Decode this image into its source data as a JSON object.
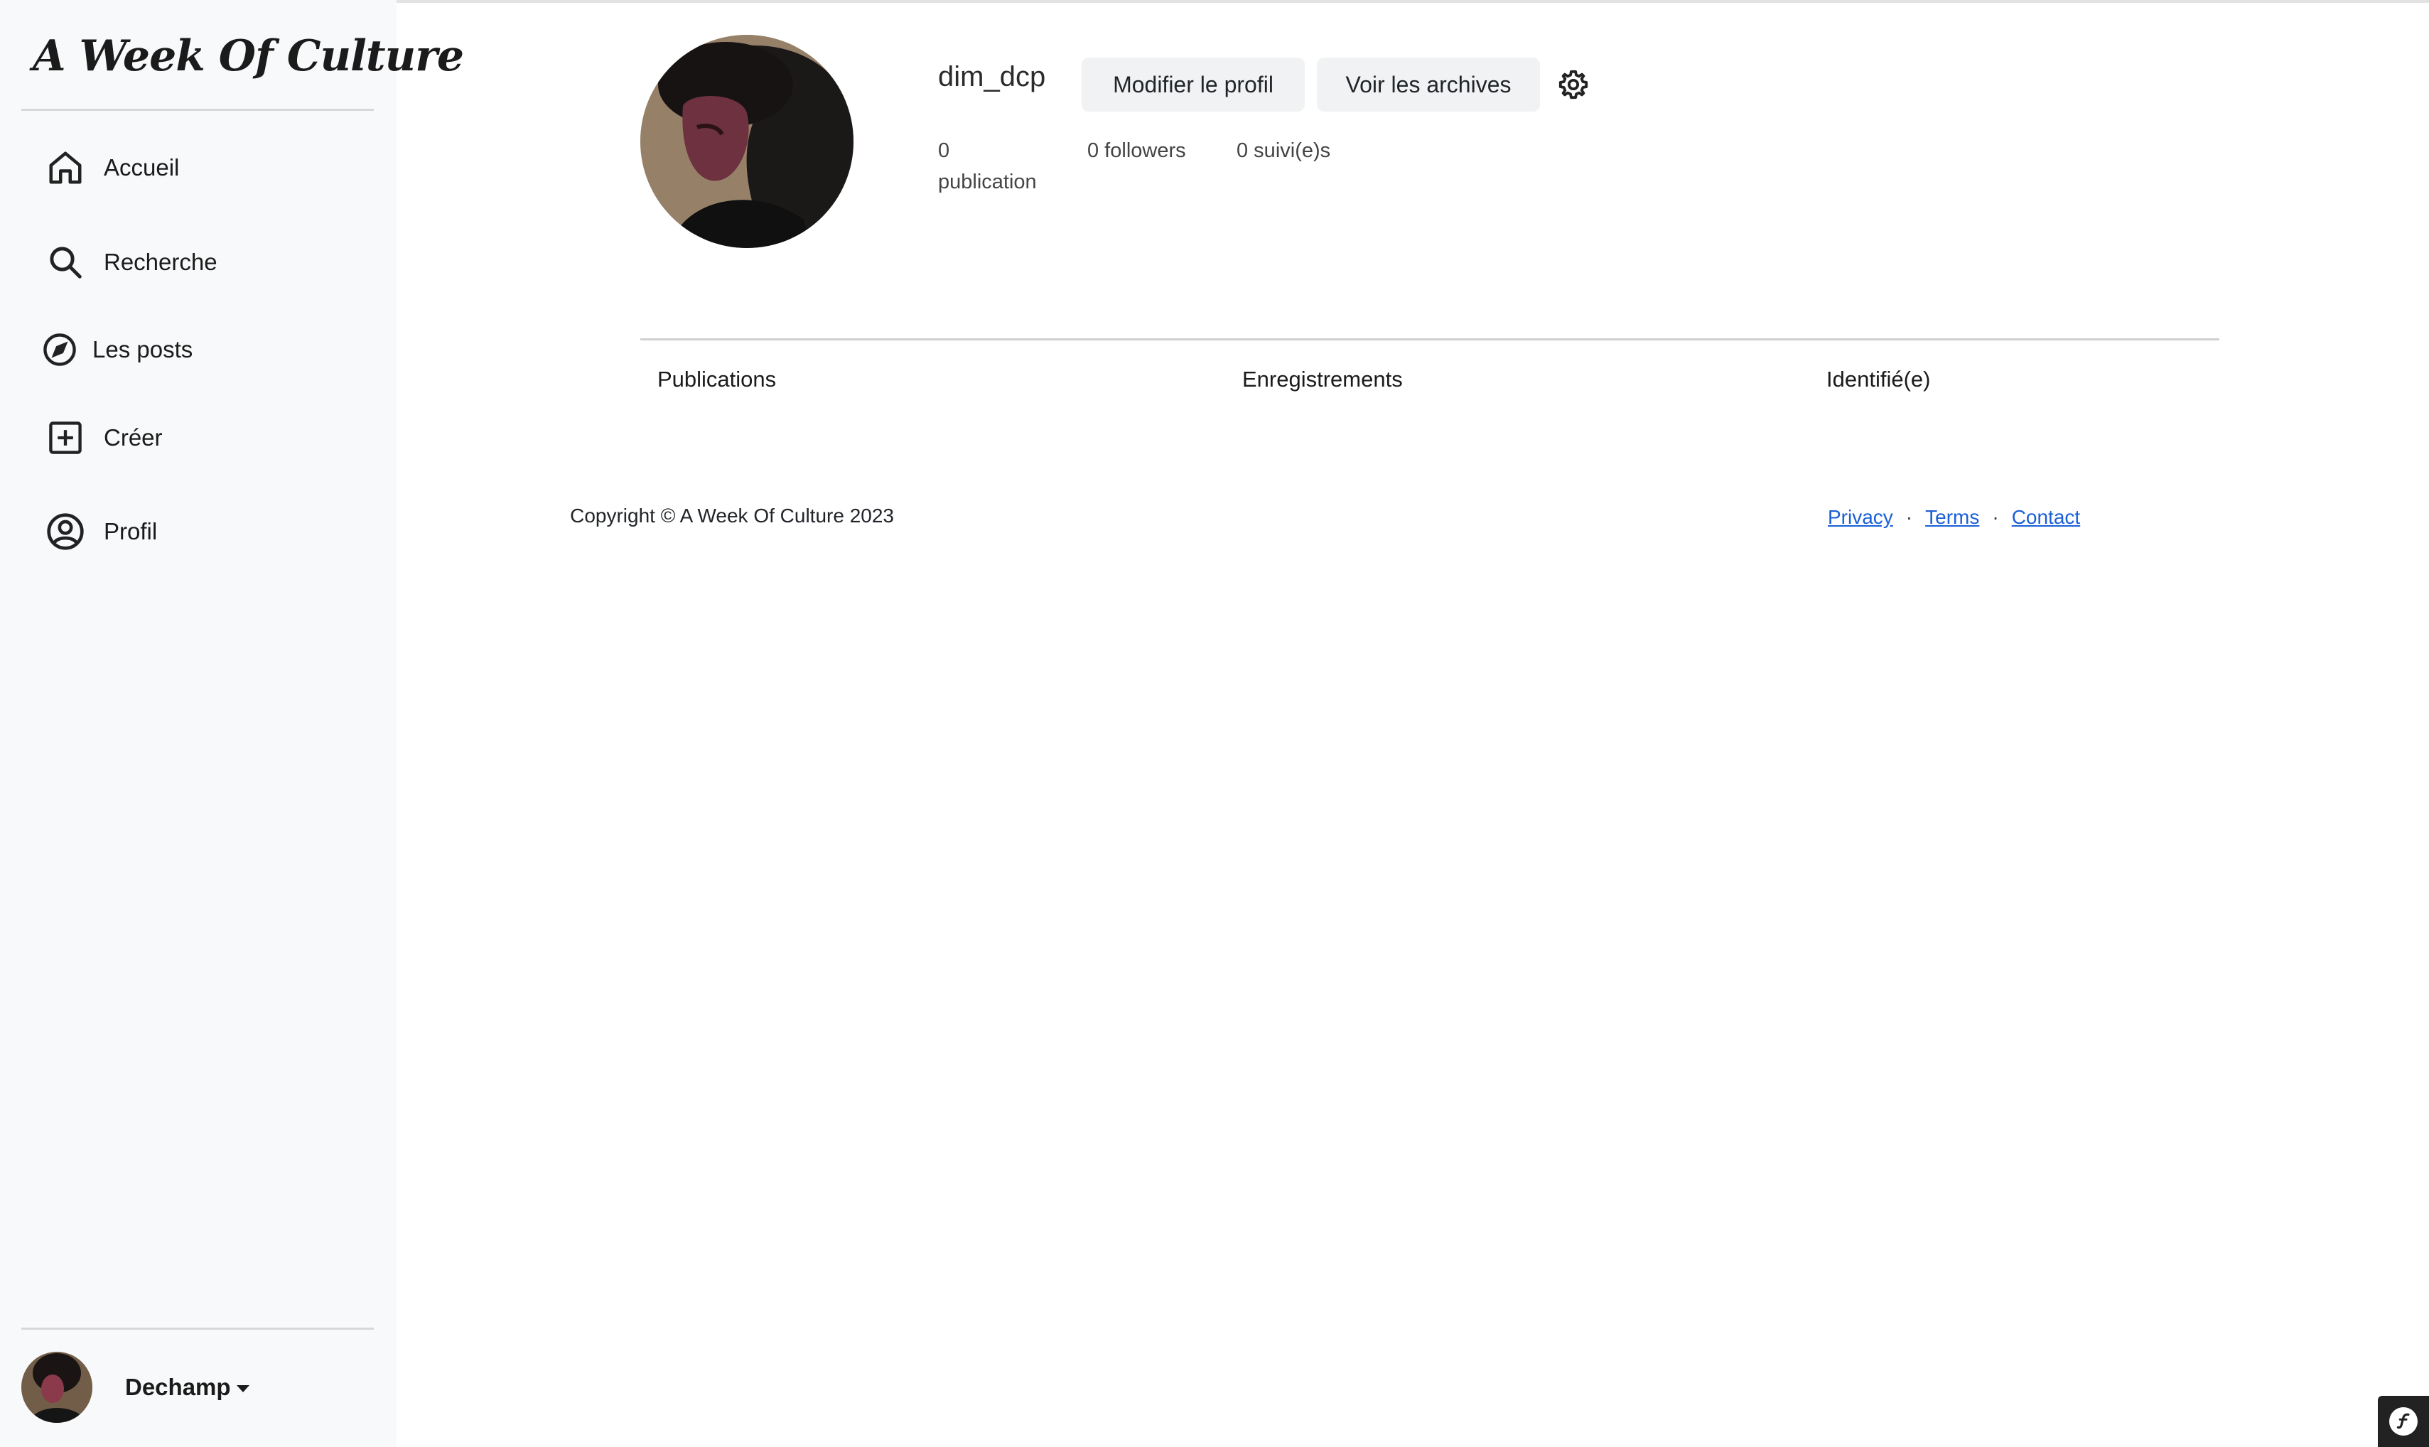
{
  "brand": {
    "name": "A Week Of Culture"
  },
  "sidebar": {
    "items": [
      {
        "label": "Accueil",
        "icon": "home-icon"
      },
      {
        "label": "Recherche",
        "icon": "search-icon"
      },
      {
        "label": "Les posts",
        "icon": "compass-icon"
      },
      {
        "label": "Créer",
        "icon": "plus-square-icon"
      },
      {
        "label": "Profil",
        "icon": "user-circle-icon"
      }
    ],
    "user": {
      "name": "Dechamp"
    }
  },
  "profile": {
    "username": "dim_dcp",
    "edit_label": "Modifier le profil",
    "archives_label": "Voir les archives",
    "stats": {
      "publications": "0 publication",
      "followers": "0 followers",
      "following": "0 suivi(e)s"
    }
  },
  "tabs": [
    {
      "label": "Publications"
    },
    {
      "label": "Enregistrements"
    },
    {
      "label": "Identifié(e)"
    }
  ],
  "footer": {
    "copyright": "Copyright © A Week Of Culture 2023",
    "links": [
      "Privacy",
      "Terms",
      "Contact"
    ]
  },
  "colors": {
    "sidebar_bg": "#f8f9fa",
    "link": "#1a5fd6",
    "button_bg": "#f1f2f3"
  }
}
